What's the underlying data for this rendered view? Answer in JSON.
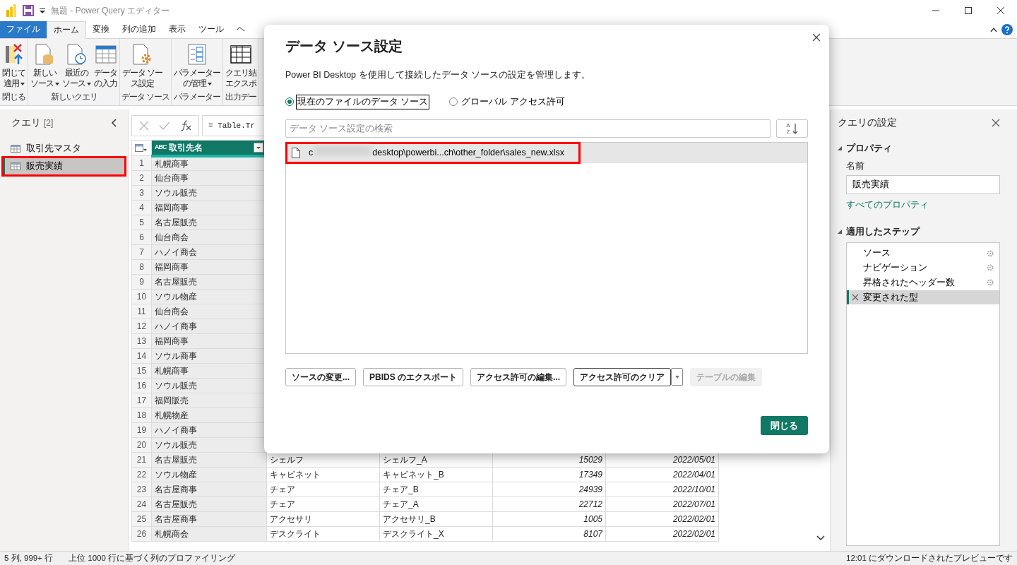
{
  "window": {
    "title": "無題 - Power Query エディター"
  },
  "ribbon_tabs": [
    {
      "label": "ファイル",
      "kind": "file",
      "selected": false
    },
    {
      "label": "ホーム",
      "kind": "tab",
      "selected": true
    },
    {
      "label": "変換",
      "kind": "tab",
      "selected": false
    },
    {
      "label": "列の追加",
      "kind": "tab",
      "selected": false
    },
    {
      "label": "表示",
      "kind": "tab",
      "selected": false
    },
    {
      "label": "ツール",
      "kind": "tab",
      "selected": false
    },
    {
      "label": "ヘ",
      "kind": "tab",
      "selected": false
    }
  ],
  "ribbon_groups": [
    {
      "label": "閉じる",
      "buttons": [
        {
          "kind": "close-apply",
          "lines": [
            "閉じて",
            "適用"
          ],
          "dropdown": true
        }
      ]
    },
    {
      "label": "新しいクエリ",
      "buttons": [
        {
          "kind": "new-source",
          "lines": [
            "新しい",
            "ソース"
          ],
          "dropdown": true
        },
        {
          "kind": "recent-source",
          "lines": [
            "最近の",
            "ソース"
          ],
          "dropdown": true
        },
        {
          "kind": "enter-data",
          "lines": [
            "データ",
            "の入力"
          ],
          "dropdown": false
        }
      ]
    },
    {
      "label": "データ ソース",
      "buttons": [
        {
          "kind": "source-settings",
          "lines": [
            "データ ソー",
            "ス設定"
          ],
          "dropdown": false
        }
      ]
    },
    {
      "label": "パラメーター",
      "buttons": [
        {
          "kind": "parameters",
          "lines": [
            "パラメーター",
            "の管理"
          ],
          "dropdown": true
        }
      ]
    },
    {
      "label": "出力デー",
      "buttons": [
        {
          "kind": "export",
          "lines": [
            "クエリ結",
            "エクスポ"
          ],
          "dropdown": false
        }
      ]
    }
  ],
  "queries": {
    "title": "クエリ",
    "count": "[2]",
    "items": [
      {
        "name": "取引先マスタ",
        "selected": false,
        "highlighted": false
      },
      {
        "name": "販売実績",
        "selected": true,
        "highlighted": true
      }
    ]
  },
  "formula": {
    "text": "= Table.Tr"
  },
  "table": {
    "columns": [
      {
        "name": "取引先名",
        "type_label": "ABC",
        "selected": true
      }
    ],
    "rows": [
      {
        "n": "1",
        "cells": [
          "札幌商事"
        ]
      },
      {
        "n": "2",
        "cells": [
          "仙台商事"
        ]
      },
      {
        "n": "3",
        "cells": [
          "ソウル販売"
        ]
      },
      {
        "n": "4",
        "cells": [
          "福岡商事"
        ]
      },
      {
        "n": "5",
        "cells": [
          "名古屋販売"
        ]
      },
      {
        "n": "6",
        "cells": [
          "仙台商会"
        ]
      },
      {
        "n": "7",
        "cells": [
          "ハノイ商会"
        ]
      },
      {
        "n": "8",
        "cells": [
          "福岡商事"
        ]
      },
      {
        "n": "9",
        "cells": [
          "名古屋販売"
        ]
      },
      {
        "n": "10",
        "cells": [
          "ソウル物産"
        ]
      },
      {
        "n": "11",
        "cells": [
          "仙台商会"
        ]
      },
      {
        "n": "12",
        "cells": [
          "ハノイ商事"
        ]
      },
      {
        "n": "13",
        "cells": [
          "福岡商事"
        ]
      },
      {
        "n": "14",
        "cells": [
          "ソウル商事"
        ]
      },
      {
        "n": "15",
        "cells": [
          "札幌商事"
        ]
      },
      {
        "n": "16",
        "cells": [
          "ソウル販売"
        ]
      },
      {
        "n": "17",
        "cells": [
          "福岡販売"
        ]
      },
      {
        "n": "18",
        "cells": [
          "札幌物産"
        ]
      },
      {
        "n": "19",
        "cells": [
          "ハノイ商事"
        ]
      },
      {
        "n": "20",
        "cells": [
          "ソウル販売"
        ]
      },
      {
        "n": "21",
        "cells": [
          "名古屋販売",
          "シェルフ",
          "シェルフ_A",
          "15029",
          "2022/05/01"
        ]
      },
      {
        "n": "22",
        "cells": [
          "ソウル物産",
          "キャビネット",
          "キャビネット_B",
          "17349",
          "2022/04/01"
        ]
      },
      {
        "n": "23",
        "cells": [
          "名古屋商事",
          "チェア",
          "チェア_B",
          "24939",
          "2022/10/01"
        ]
      },
      {
        "n": "24",
        "cells": [
          "名古屋販売",
          "チェア",
          "チェア_A",
          "22712",
          "2022/07/01"
        ]
      },
      {
        "n": "25",
        "cells": [
          "名古屋商事",
          "アクセサリ",
          "アクセサリ_B",
          "1005",
          "2022/02/01"
        ]
      },
      {
        "n": "26",
        "cells": [
          "札幌商会",
          "デスクライト",
          "デスクライト_X",
          "8107",
          "2022/02/01"
        ]
      }
    ]
  },
  "settings": {
    "title": "クエリの設定",
    "properties_title": "プロパティ",
    "name_label": "名前",
    "name_value": "販売実績",
    "all_properties_link": "すべてのプロパティ",
    "steps_title": "適用したステップ",
    "steps": [
      {
        "name": "ソース",
        "has_settings": true,
        "selected": false
      },
      {
        "name": "ナビゲーション",
        "has_settings": true,
        "selected": false
      },
      {
        "name": "昇格されたヘッダー数",
        "has_settings": true,
        "selected": false
      },
      {
        "name": "変更された型",
        "has_settings": false,
        "selected": true
      }
    ]
  },
  "status_bar": {
    "left": "5 列, 999+ 行",
    "middle": "上位 1000 行に基づく列のプロファイリング",
    "right": "12:01 にダウンロードされたプレビューです"
  },
  "dialog": {
    "title": "データ ソース設定",
    "description": "Power BI Desktop を使用して接続したデータ ソースの設定を管理します。",
    "options": [
      {
        "label": "現在のファイルのデータ ソース",
        "selected": true,
        "focused": true
      },
      {
        "label": "グローバル アクセス許可",
        "selected": false,
        "focused": false
      }
    ],
    "search": {
      "placeholder": "データ ソース設定の検索"
    },
    "sort_button": {
      "top": "A",
      "bottom": "Z"
    },
    "sources": [
      {
        "path_prefix": "c",
        "redacted": true,
        "path_suffix": "desktop\\powerbi...ch\\other_folder\\sales_new.xlsx",
        "selected": true,
        "highlighted": true
      }
    ],
    "buttons": [
      {
        "label": "ソースの変更...",
        "disabled": false,
        "focused": false,
        "split": false
      },
      {
        "label": "PBIDS のエクスポート",
        "disabled": false,
        "focused": false,
        "split": false
      },
      {
        "label": "アクセス許可の編集...",
        "disabled": false,
        "focused": false,
        "split": false
      },
      {
        "label": "アクセス許可のクリア",
        "disabled": false,
        "focused": true,
        "split": true
      },
      {
        "label": "テーブルの編集",
        "disabled": true,
        "focused": false,
        "split": false
      }
    ],
    "close_button": "閉じる"
  }
}
